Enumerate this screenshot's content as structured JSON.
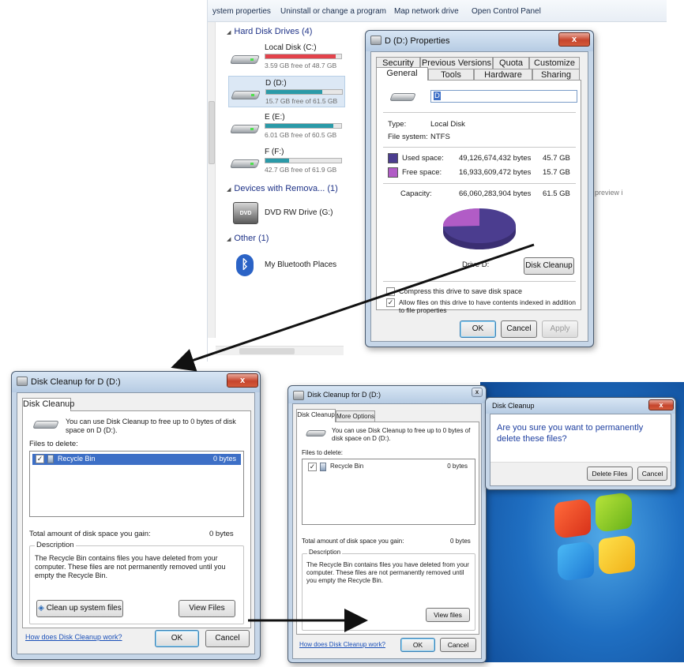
{
  "explorer": {
    "toolbar": [
      "ystem properties",
      "Uninstall or change a program",
      "Map network drive",
      "Open Control Panel"
    ],
    "groups": {
      "hard_disks": "Hard Disk Drives (4)",
      "removable": "Devices with Remova... (1)",
      "other": "Other (1)"
    },
    "drives": [
      {
        "name": "Local Disk (C:)",
        "free": "3.59 GB free of 48.7 GB",
        "used_fraction": 0.93,
        "bar_color": "#e3424b"
      },
      {
        "name": "D (D:)",
        "free": "15.7 GB free of 61.5 GB",
        "used_fraction": 0.74,
        "bar_color": "#2a9aa8"
      },
      {
        "name": "E (E:)",
        "free": "6.01 GB free of 60.5 GB",
        "used_fraction": 0.9,
        "bar_color": "#2a9aa8"
      },
      {
        "name": "F (F:)",
        "free": "42.7 GB free of 61.9 GB",
        "used_fraction": 0.31,
        "bar_color": "#2a9aa8"
      }
    ],
    "devices": [
      {
        "name": "DVD RW Drive (G:)",
        "icon": "dvd-icon"
      }
    ],
    "other": [
      {
        "name": "My Bluetooth Places",
        "icon": "bluetooth-icon"
      }
    ],
    "preview_text": "is preview i"
  },
  "properties": {
    "title": "D (D:) Properties",
    "close": "x",
    "tabs_top": [
      "Security",
      "Previous Versions",
      "Quota",
      "Customize"
    ],
    "tabs_bottom": [
      "General",
      "Tools",
      "Hardware",
      "Sharing"
    ],
    "volume_label": "D",
    "type_label": "Type:",
    "type_value": "Local Disk",
    "fs_label": "File system:",
    "fs_value": "NTFS",
    "used_label": "Used space:",
    "used_bytes": "49,126,674,432 bytes",
    "used_gb": "45.7 GB",
    "free_label": "Free space:",
    "free_bytes": "16,933,609,472 bytes",
    "free_gb": "15.7 GB",
    "capacity_label": "Capacity:",
    "capacity_bytes": "66,060,283,904 bytes",
    "capacity_gb": "61.5 GB",
    "drive_caption": "Drive D:",
    "disk_cleanup": "Disk Cleanup",
    "compress_label": "Compress this drive to save disk space",
    "index_label": "Allow files on this drive to have contents indexed in addition to file properties",
    "ok": "OK",
    "cancel": "Cancel",
    "apply": "Apply",
    "used_color": "#4b3d8f",
    "free_color": "#b15cc6"
  },
  "cleanup1": {
    "title": "Disk Cleanup for D (D:)",
    "close": "x",
    "tab": "Disk Cleanup",
    "intro": "You can use Disk Cleanup to free up to 0 bytes of disk space on D (D:).",
    "files_label": "Files to delete:",
    "items": [
      {
        "name": "Recycle Bin",
        "size": "0 bytes",
        "checked": true
      }
    ],
    "total_label": "Total amount of disk space you gain:",
    "total_value": "0 bytes",
    "desc_legend": "Description",
    "desc_text": "The Recycle Bin contains files you have deleted from your computer. These files are not permanently removed until you empty the Recycle Bin.",
    "cleanup_sys": "Clean up system files",
    "view_files": "View Files",
    "how_link": "How does Disk Cleanup work?",
    "ok": "OK",
    "cancel": "Cancel"
  },
  "cleanup2": {
    "title": "Disk Cleanup for D (D:)",
    "close": "x",
    "tabs": [
      "Disk Cleanup",
      "More Options"
    ],
    "intro": "You can use Disk Cleanup to free up to 0 bytes of disk space on D (D:).",
    "files_label": "Files to delete:",
    "items": [
      {
        "name": "Recycle Bin",
        "size": "0 bytes",
        "checked": true
      }
    ],
    "total_label": "Total amount of disk space you gain:",
    "total_value": "0 bytes",
    "desc_legend": "Description",
    "desc_text": "The Recycle Bin contains files you have deleted from your computer. These files are not permanently removed until you empty the Recycle Bin.",
    "view_files": "View files",
    "how_link": "How does Disk Cleanup work?",
    "ok": "OK",
    "cancel": "Cancel"
  },
  "confirm": {
    "title": "Disk Cleanup",
    "close": "x",
    "message": "Are you sure you want to permanently delete these files?",
    "delete": "Delete Files",
    "cancel": "Cancel",
    "message_color": "#1e3fa0"
  }
}
